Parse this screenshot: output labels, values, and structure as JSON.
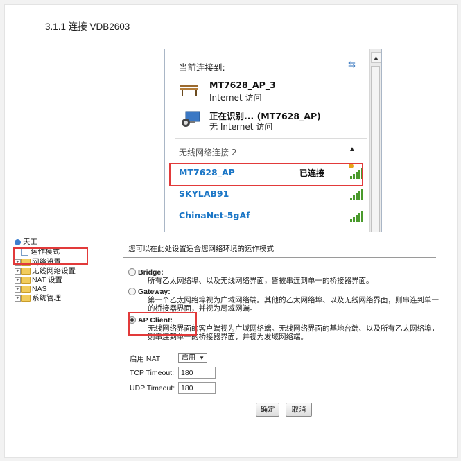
{
  "heading": "3.1.1 连接 VDB2603",
  "wifi_popup": {
    "title": "当前连接到:",
    "connections": [
      {
        "name": "MT7628_AP_3",
        "sub": "Internet 访问",
        "icon": "bench-network-icon"
      },
      {
        "name": "正在识别... (MT7628_AP)",
        "sub": "无 Internet 访问",
        "icon": "monitor-network-icon"
      }
    ],
    "section_title": "无线网络连接 2",
    "networks": [
      {
        "name": "MT7628_AP",
        "status": "已连接"
      },
      {
        "name": "SKYLAB91",
        "status": ""
      },
      {
        "name": "ChinaNet-5gAf",
        "status": ""
      }
    ]
  },
  "tree": {
    "root": "天工",
    "items": [
      "运作模式",
      "网络设置",
      "无线网络设置",
      "NAT 设置",
      "NAS",
      "系统管理"
    ]
  },
  "form": {
    "intro": "您可以在此处设置适合您网络环境的运作模式",
    "options": [
      {
        "label": "Bridge:",
        "desc": "所有乙太网络埠、以及无线网络界面，皆被串连到单一的桥接器界面。",
        "selected": false
      },
      {
        "label": "Gateway:",
        "desc": "第一个乙太网络埠视为广域网络端。其他的乙太网络埠、以及无线网络界面，则串连到单一的桥接器界面，并视为局域网端。",
        "selected": false
      },
      {
        "label": "AP Client:",
        "desc": "无线网络界面的客户端视为广域网络端。无线网络界面的基地台端、以及所有乙太网络埠，则串连到单一的桥接器界面，并视为发域网络端。",
        "selected": true
      }
    ],
    "nat_label": "启用 NAT",
    "nat_value": "启用",
    "tcp_label": "TCP Timeout:",
    "tcp_value": "180",
    "udp_label": "UDP Timeout:",
    "udp_value": "180",
    "ok_label": "确定",
    "cancel_label": "取消"
  }
}
